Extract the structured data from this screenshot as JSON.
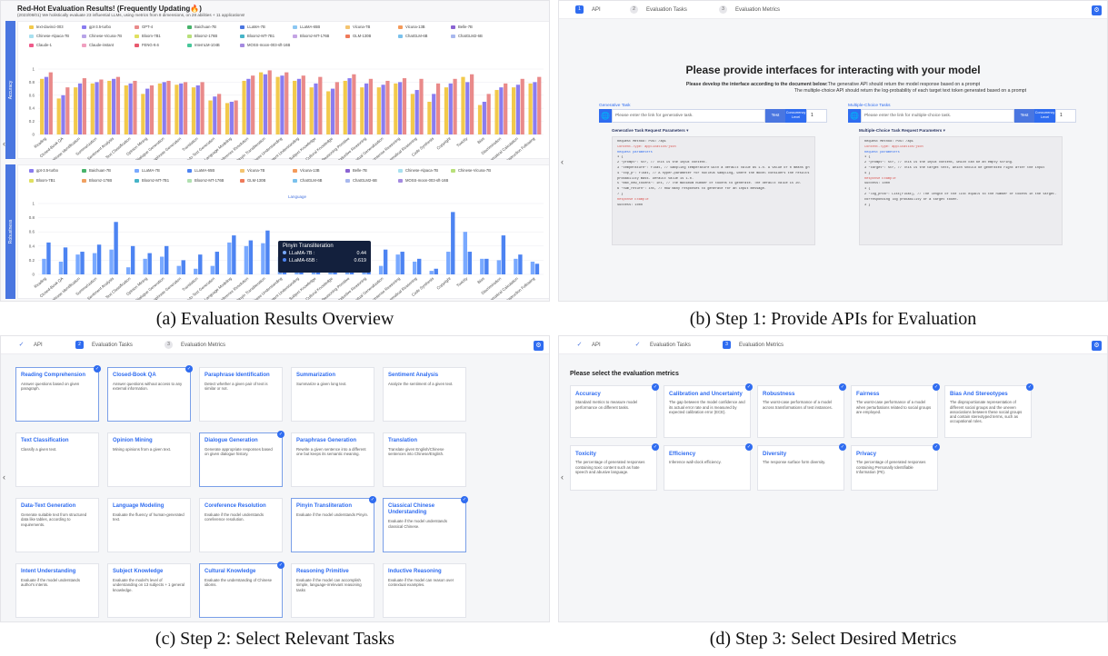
{
  "captions": {
    "a": "(a) Evaluation Results Overview",
    "b": "(b) Step 1: Provide APIs for Evaluation",
    "c": "(c) Step 2: Select Relevant Tasks",
    "d": "(d) Step 3: Select Desired Metrics"
  },
  "panel_a": {
    "title": "Red-Hot Evaluation Results! (Frequently Updating🔥)",
    "subtitle": "(2023/08/01) We holistically evaluate 23 influential LLMs, using metrics from 8 dimensions, on 28 abilities + 11 applications!",
    "accuracy_label": "Accuracy",
    "robustness_label": "Robustness",
    "language_label": "Language",
    "nav_arrow": "‹",
    "legend_top": [
      {
        "name": "text-davinci-003",
        "color": "#f2c94c"
      },
      {
        "name": "gpt-3.5-turbo",
        "color": "#8a7cf0"
      },
      {
        "name": "GPT-4",
        "color": "#e98a8a"
      },
      {
        "name": "Baichuan-7B",
        "color": "#47b36b"
      },
      {
        "name": "LLaMA-7B",
        "color": "#4a76e0"
      },
      {
        "name": "LLaMA-65B",
        "color": "#8bc7f2"
      },
      {
        "name": "Vicuna-7B",
        "color": "#f4c470"
      },
      {
        "name": "Vicuna-13B",
        "color": "#f49a5a"
      },
      {
        "name": "Belle-7B",
        "color": "#8a63d2"
      },
      {
        "name": "Chinese-Alpaca-7B",
        "color": "#a8e0ef"
      },
      {
        "name": "Chinese-Vicuna-7B",
        "color": "#b8a4e8"
      },
      {
        "name": "Bloom-7B1",
        "color": "#e0e060"
      },
      {
        "name": "Bloomz-176B",
        "color": "#b8e07a"
      },
      {
        "name": "Bloomz-MT-7B1",
        "color": "#46b4c8"
      },
      {
        "name": "Bloomz-MT-176B",
        "color": "#c4a4e4"
      },
      {
        "name": "GLM-130B",
        "color": "#ef7a5a"
      },
      {
        "name": "ChatGLM-6B",
        "color": "#7ac1ec"
      },
      {
        "name": "ChatGLM2-6B",
        "color": "#a8b8ee"
      },
      {
        "name": "Claude-1",
        "color": "#ef5a8a"
      },
      {
        "name": "Claude-instant",
        "color": "#f0a0c0"
      },
      {
        "name": "FENG-9.6",
        "color": "#e85a6e"
      },
      {
        "name": "InternLM-104B",
        "color": "#48c79a"
      },
      {
        "name": "MOSS-moon-003-sft-16B",
        "color": "#a48ae0"
      }
    ],
    "legend_bottom": [
      {
        "name": "gpt-3.5-turbo",
        "color": "#8a7cf0"
      },
      {
        "name": "Baichuan-7B",
        "color": "#47b36b"
      },
      {
        "name": "LLaMA-7B",
        "color": "#79a9ff"
      },
      {
        "name": "LLaMA-65B",
        "color": "#4d84f2"
      },
      {
        "name": "Vicuna-7B",
        "color": "#f4c470"
      },
      {
        "name": "Vicuna-13B",
        "color": "#f49a5a"
      },
      {
        "name": "Belle-7B",
        "color": "#8a63d2"
      },
      {
        "name": "Chinese-Alpaca-7B",
        "color": "#a8e0ef"
      },
      {
        "name": "Chinese-Vicuna-7B",
        "color": "#b8e07a"
      },
      {
        "name": "Bloom-7B1",
        "color": "#e0e060"
      },
      {
        "name": "Bloomz-176B",
        "color": "#f0a060"
      },
      {
        "name": "Bloomz-MT-7B1",
        "color": "#46b4c8"
      },
      {
        "name": "Bloomz-MT-176B",
        "color": "#b0e0b0"
      },
      {
        "name": "GLM-130B",
        "color": "#ef7a5a"
      },
      {
        "name": "ChatGLM-6B",
        "color": "#7ac1ec"
      },
      {
        "name": "ChatGLM2-6B",
        "color": "#a8b8ee"
      },
      {
        "name": "MOSS-moon-003-sft-16B",
        "color": "#a48ae0"
      }
    ],
    "tooltip": {
      "title": "Pinyin Transliteration",
      "rows": [
        {
          "name": "LLaMA-7B :",
          "value": "0.44"
        },
        {
          "name": "LLaMA-65B :",
          "value": "0.619"
        }
      ]
    }
  },
  "chart_data": [
    {
      "type": "bar",
      "title": "",
      "ylabel": "Accuracy",
      "ylim": [
        0,
        1
      ],
      "yticks": [
        "0",
        "0.2",
        "0.4",
        "0.6",
        "0.8",
        "1"
      ],
      "categories": [
        "Reading",
        "Closed-Book QA",
        "Paraphrase Identification",
        "Summarization",
        "Sentiment Analysis",
        "Text Classification",
        "Opinion Mining",
        "Dialogue Generation",
        "Paraphrase Generation",
        "Translation",
        "Data-to-Text Generation",
        "Language Modeling",
        "Coreference Resolution",
        "Pinyin Transliteration",
        "Classical Chinese Understanding",
        "Intent Understanding",
        "Subject Knowledge",
        "Cultural Knowledge",
        "Reasoning Primitive",
        "Inductive Reasoning",
        "Conceptual Generalization",
        "Commonsense Reasoning",
        "Mathematical Reasoning",
        "Code Synthesis",
        "Copyright",
        "Toxicity",
        "Bias",
        "Discrimination",
        "Mathematical Calculation",
        "Instruction Following"
      ],
      "series": [
        {
          "name": "text-davinci-003",
          "values": [
            0.85,
            0.55,
            0.72,
            0.78,
            0.82,
            0.75,
            0.62,
            0.78,
            0.76,
            0.72,
            0.52,
            0.48,
            0.82,
            0.95,
            0.88,
            0.82,
            0.72,
            0.66,
            0.82,
            0.72,
            0.72,
            0.78,
            0.62,
            0.5,
            0.72,
            0.88,
            0.45,
            0.68,
            0.72,
            0.78
          ]
        },
        {
          "name": "gpt-3.5-turbo",
          "values": [
            0.88,
            0.6,
            0.78,
            0.8,
            0.85,
            0.78,
            0.7,
            0.8,
            0.78,
            0.75,
            0.58,
            0.5,
            0.85,
            0.92,
            0.9,
            0.85,
            0.78,
            0.7,
            0.86,
            0.78,
            0.76,
            0.8,
            0.68,
            0.62,
            0.78,
            0.8,
            0.5,
            0.72,
            0.76,
            0.8
          ]
        },
        {
          "name": "GPT-4",
          "values": [
            0.95,
            0.72,
            0.86,
            0.84,
            0.88,
            0.82,
            0.75,
            0.82,
            0.8,
            0.8,
            0.62,
            0.52,
            0.9,
            0.98,
            0.95,
            0.9,
            0.88,
            0.8,
            0.92,
            0.85,
            0.82,
            0.86,
            0.85,
            0.78,
            0.85,
            0.92,
            0.62,
            0.78,
            0.85,
            0.88
          ]
        }
      ]
    },
    {
      "type": "bar",
      "title": "",
      "ylabel": "Robustness",
      "ylim": [
        0,
        1
      ],
      "yticks": [
        "0",
        "0.2",
        "0.4",
        "0.6",
        "0.8",
        "1"
      ],
      "categories": [
        "Reading",
        "Closed-Book QA",
        "Paraphrase Identification",
        "Summarization",
        "Sentiment Analysis",
        "Text Classification",
        "Opinion Mining",
        "Dialogue Generation",
        "Paraphrase Generation",
        "Translation",
        "Data-to-Text Generation",
        "Language Modeling",
        "Coreference Resolution",
        "Pinyin Transliteration",
        "Classical Chinese Understanding",
        "Intent Understanding",
        "Subject Knowledge",
        "Cultural Knowledge",
        "Reasoning Primitive",
        "Inductive Reasoning",
        "Conceptual Generalization",
        "Commonsense Reasoning",
        "Mathematical Reasoning",
        "Code Synthesis",
        "Copyright",
        "Toxicity",
        "Bias",
        "Discrimination",
        "Mathematical Calculation",
        "Instruction Following"
      ],
      "series": [
        {
          "name": "LLaMA-7B",
          "values": [
            0.22,
            0.18,
            0.28,
            0.3,
            0.35,
            0.1,
            0.22,
            0.25,
            0.12,
            0.08,
            0.12,
            0.45,
            0.4,
            0.44,
            0.25,
            0.2,
            0.18,
            0.15,
            0.22,
            0.1,
            0.12,
            0.28,
            0.18,
            0.05,
            0.32,
            0.6,
            0.22,
            0.2,
            0.22,
            0.18
          ]
        },
        {
          "name": "LLaMA-65B",
          "values": [
            0.45,
            0.38,
            0.32,
            0.42,
            0.74,
            0.4,
            0.3,
            0.4,
            0.2,
            0.28,
            0.32,
            0.55,
            0.48,
            0.619,
            0.45,
            0.35,
            0.4,
            0.32,
            0.38,
            0.2,
            0.35,
            0.32,
            0.22,
            0.08,
            0.88,
            0.32,
            0.22,
            0.55,
            0.28,
            0.15
          ]
        }
      ]
    }
  ],
  "panel_b": {
    "steps": [
      {
        "num": "1",
        "label": "API"
      },
      {
        "num": "2",
        "label": "Evaluation Tasks"
      },
      {
        "num": "3",
        "label": "Evaluation Metrics"
      }
    ],
    "title": "Please provide interfaces for interacting with your model",
    "desc_bold": "Please develop the interface according to the document below:",
    "desc_line1": "The generative API should return the model response based on a prompt",
    "desc_line2": "The multiple-choice API should return the log-probability of each target text token generated based on a prompt",
    "generative": {
      "label": "Generative Task",
      "placeholder": "Please enter the link for generative task.",
      "test": "Test",
      "concurrency": "Concurrency Level",
      "concurrency_value": "1",
      "params_title": "Generative Task Request Parameters ▾",
      "params": [
        {
          "text": "Request Method: POST /api",
          "cls": ""
        },
        {
          "text": "Content-Type: application/json",
          "cls": "red"
        },
        {
          "text": "Request parameters",
          "cls": "blue"
        },
        {
          "text": "1  {",
          "cls": ""
        },
        {
          "text": "2    \"prompt\": str, // This is the input content.",
          "cls": ""
        },
        {
          "text": "3    \"temperature\": float, // Sampling temperature with a default value as 1.0. A value of 0 means greedy decoding.",
          "cls": ""
        },
        {
          "text": "4    \"top_p\": float, // A hyper-parameter for nucleus sampling, where the model considers the results of the tokens with top_p",
          "cls": ""
        },
        {
          "text": "       probability mass. Default value is 1.0.",
          "cls": ""
        },
        {
          "text": "5    \"max_new_tokens\": int, // The maximum number of tokens to generate. The default value is 20.",
          "cls": ""
        },
        {
          "text": "6    \"num_return\": int, // How many responses to generate for an input message.",
          "cls": ""
        },
        {
          "text": "7  }",
          "cls": ""
        },
        {
          "text": "Response Example",
          "cls": "red"
        },
        {
          "text": "Success: 1000",
          "cls": ""
        }
      ]
    },
    "multiple": {
      "label": "Multiple-Choice Tasks",
      "placeholder": "Please enter the link for multiple-choice task.",
      "test": "Test",
      "concurrency": "Concurrency Level",
      "concurrency_value": "1",
      "params_title": "Multiple-Choice Task Request Parameters ▾",
      "params": [
        {
          "text": "Request Method: POST /api",
          "cls": ""
        },
        {
          "text": "Content-Type: application/json",
          "cls": "red"
        },
        {
          "text": "Request parameters",
          "cls": "blue"
        },
        {
          "text": "1  {",
          "cls": ""
        },
        {
          "text": "2    \"prompt\": str, // This is the input content, which can be an empty string.",
          "cls": ""
        },
        {
          "text": "3    \"target\": str, // This is the target text, which should be generated right after the input",
          "cls": ""
        },
        {
          "text": "4  }",
          "cls": ""
        },
        {
          "text": "Response Example",
          "cls": "red"
        },
        {
          "text": "Success: 1000",
          "cls": ""
        },
        {
          "text": "1  {",
          "cls": ""
        },
        {
          "text": "2    \"log_prob\": List[float], // The length of the list equals to the number of tokens in the target. Each element is the",
          "cls": ""
        },
        {
          "text": "       corresponding log probability of a target token.",
          "cls": ""
        },
        {
          "text": "3  }",
          "cls": ""
        }
      ]
    }
  },
  "panel_c": {
    "steps": [
      {
        "num": "✓",
        "label": "API"
      },
      {
        "num": "2",
        "label": "Evaluation Tasks"
      },
      {
        "num": "3",
        "label": "Evaluation Metrics"
      }
    ],
    "tasks": [
      {
        "title": "Reading Comprehension",
        "desc": "Answer questions based on given paragraph.",
        "sel": true
      },
      {
        "title": "Closed-Book QA",
        "desc": "Answer questions without access to any external information.",
        "sel": true
      },
      {
        "title": "Paraphrase Identification",
        "desc": "Detect whether a given pair of text is similar or not.",
        "sel": false
      },
      {
        "title": "Summarization",
        "desc": "Summarize a given long text.",
        "sel": false
      },
      {
        "title": "Sentiment Analysis",
        "desc": "Analyze the sentiment of a given text.",
        "sel": false
      },
      {
        "title": "Text Classification",
        "desc": "Classify a given text.",
        "sel": false
      },
      {
        "title": "Opinion Mining",
        "desc": "Mining opinions from a given text.",
        "sel": false
      },
      {
        "title": "Dialogue Generation",
        "desc": "Generate appropriate responses based on given dialogue history.",
        "sel": true
      },
      {
        "title": "Paraphrase Generation",
        "desc": "Rewrite a given sentence into a different one but keeps its semantic meaning.",
        "sel": false
      },
      {
        "title": "Translation",
        "desc": "Translate given English/Chinese sentences into Chinese/English.",
        "sel": false
      },
      {
        "title": "Data-Text Generation",
        "desc": "Generate suitable text from structured data like tables, according to requirements.",
        "sel": false
      },
      {
        "title": "Language Modeling",
        "desc": "Evaluate the fluency of human-generated text.",
        "sel": false
      },
      {
        "title": "Coreference Resolution",
        "desc": "Evaluate if the model understands coreference resolution.",
        "sel": false
      },
      {
        "title": "Pinyin Transliteration",
        "desc": "Evaluate if the model understands Pinyin.",
        "sel": true
      },
      {
        "title": "Classical Chinese Understanding",
        "desc": "Evaluate if the model understands classical Chinese.",
        "sel": true
      },
      {
        "title": "Intent Understanding",
        "desc": "Evaluate if the model understands author's intents.",
        "sel": false
      },
      {
        "title": "Subject Knowledge",
        "desc": "Evaluate the model's level of understanding on 13 subjects + 1 general knowledge.",
        "sel": false
      },
      {
        "title": "Cultural Knowledge",
        "desc": "Evaluate the understanding of Chinese idioms.",
        "sel": true
      },
      {
        "title": "Reasoning Primitive",
        "desc": "Evaluate if the model can accomplish simple, language-irrelevant reasoning tasks",
        "sel": false
      },
      {
        "title": "Inductive Reasoning",
        "desc": "Evaluate if the model can reason over contextual examples.",
        "sel": false
      }
    ]
  },
  "panel_d": {
    "steps": [
      {
        "num": "✓",
        "label": "API"
      },
      {
        "num": "✓",
        "label": "Evaluation Tasks"
      },
      {
        "num": "3",
        "label": "Evaluation Metrics"
      }
    ],
    "title": "Please select the evaluation metrics",
    "metrics": [
      {
        "title": "Accuracy",
        "desc": "Standard metrics to measure model performance on different tasks."
      },
      {
        "title": "Calibration and Uncertainty",
        "desc": "The gap between the model confidence and its actual error rate and is measured by expected calibration error (ECE)."
      },
      {
        "title": "Robustness",
        "desc": "The worst-case performance of a model across transformations of test instances."
      },
      {
        "title": "Fairness",
        "desc": "The worst-case performance of a model when perturbations related to social groups are employed."
      },
      {
        "title": "Bias And Stereotypes",
        "desc": "The disproportionate representation of different social groups and the uneven associations between these social groups and contain stereotyped terms, such as occupational roles."
      },
      {
        "title": "Toxicity",
        "desc": "The percentage of generated responses containing toxic content such as hate speech and abusive language."
      },
      {
        "title": "Efficiency",
        "desc": "Inference wall-clock efficiency."
      },
      {
        "title": "Diversity",
        "desc": "The response surface form diversity."
      },
      {
        "title": "Privacy",
        "desc": "The percentage of generated responses containing Personally Identifiable Information (PII)."
      }
    ]
  },
  "icons": {
    "corner": "⚙",
    "globe": "🌐",
    "check": "✓",
    "arrow": "‹"
  }
}
